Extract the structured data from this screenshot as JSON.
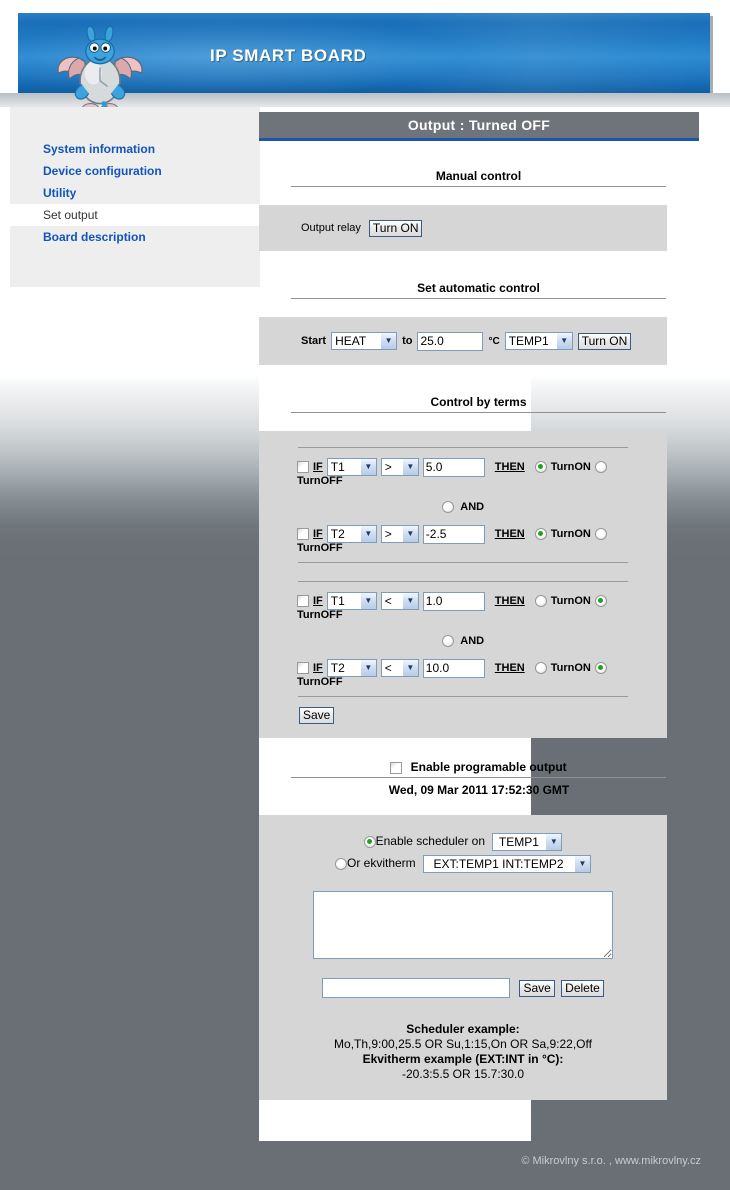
{
  "header": {
    "title": "IP SMART BOARD",
    "logo_alt": "dragon-mascot"
  },
  "sidebar": {
    "items": [
      {
        "label": "System information",
        "active": false
      },
      {
        "label": "Device configuration",
        "active": false
      },
      {
        "label": "Utility",
        "active": false
      },
      {
        "label": "Set output",
        "active": true
      },
      {
        "label": "Board description",
        "active": false
      }
    ]
  },
  "main": {
    "status_title": "Output : Turned OFF",
    "manual": {
      "heading": "Manual control",
      "relay_label": "Output relay",
      "relay_button": "Turn ON"
    },
    "automatic": {
      "heading": "Set automatic control",
      "start_label": "Start",
      "mode_value": "HEAT",
      "to_label": "to",
      "temp_value": "25.0",
      "unit_label": "°C",
      "sensor_value": "TEMP1",
      "button": "Turn ON"
    },
    "terms": {
      "heading": "Control by terms",
      "if_label": "IF",
      "then_label": "THEN",
      "turn_on_label": "TurnON",
      "turn_off_label": "TurnOFF",
      "and_label": "AND",
      "save_button": "Save",
      "rows": [
        {
          "checked": false,
          "sensor": "T1",
          "op": ">",
          "value": "5.0",
          "on_selected": true,
          "off_selected": false
        },
        {
          "checked": false,
          "sensor": "T2",
          "op": ">",
          "value": "-2.5",
          "on_selected": true,
          "off_selected": false
        },
        {
          "checked": false,
          "sensor": "T1",
          "op": "<",
          "value": "1.0",
          "on_selected": false,
          "off_selected": true
        },
        {
          "checked": false,
          "sensor": "T2",
          "op": "<",
          "value": "10.0",
          "on_selected": false,
          "off_selected": true
        }
      ]
    },
    "programmable": {
      "enable_label": "Enable programable output",
      "enabled": false,
      "timestamp": "Wed, 09 Mar 2011 17:52:30 GMT",
      "scheduler_radio_label": "Enable scheduler on",
      "scheduler_selected": true,
      "scheduler_sensor": "TEMP1",
      "ekvitherm_radio_label": "Or ekvitherm",
      "ekvitherm_selected": false,
      "ekvitherm_value": "EXT:TEMP1 INT:TEMP2",
      "textarea_value": "",
      "entry_value": "",
      "save_button": "Save",
      "delete_button": "Delete",
      "example_title": "Scheduler example:",
      "example_line": "Mo,Th,9:00,25.5  OR Su,1:15,On  OR Sa,9:22,Off",
      "ekvitherm_title": "Ekvitherm example (EXT:INT in °C):",
      "ekvitherm_line": "-20.3:5.5 OR 15.7:30.0"
    }
  },
  "footer": {
    "text": "© Mikrovlny s.r.o. , www.mikrovlny.cz"
  }
}
